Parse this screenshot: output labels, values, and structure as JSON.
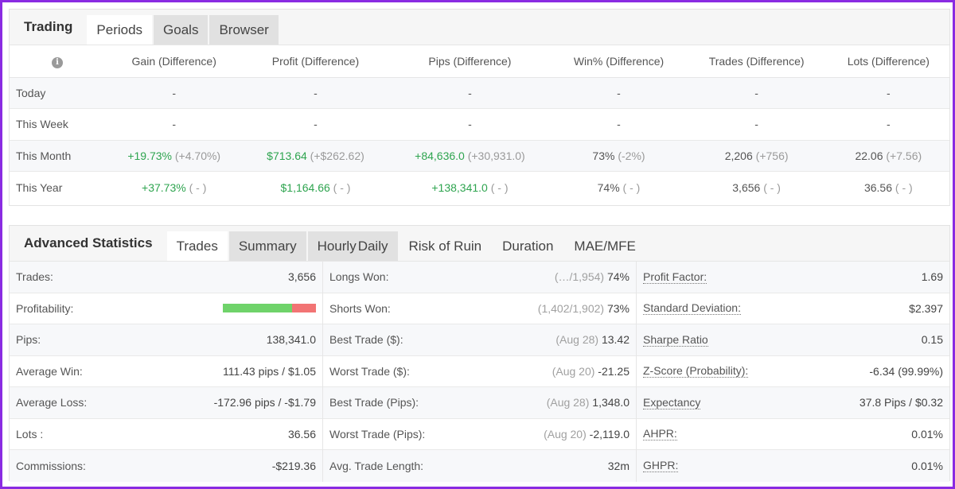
{
  "periods_panel": {
    "tabs": [
      {
        "label": "Trading",
        "type": "title"
      },
      {
        "label": "Periods",
        "active": true
      },
      {
        "label": "Goals"
      },
      {
        "label": "Browser"
      }
    ],
    "info_icon": "i",
    "columns": [
      "Gain (Difference)",
      "Profit (Difference)",
      "Pips (Difference)",
      "Win% (Difference)",
      "Trades (Difference)",
      "Lots (Difference)"
    ],
    "rows": [
      {
        "label": "Today",
        "cells": [
          {
            "main": "-",
            "diff": ""
          },
          {
            "main": "-",
            "diff": ""
          },
          {
            "main": "-",
            "diff": ""
          },
          {
            "main": "-",
            "diff": ""
          },
          {
            "main": "-",
            "diff": ""
          },
          {
            "main": "-",
            "diff": ""
          }
        ]
      },
      {
        "label": "This Week",
        "cells": [
          {
            "main": "-",
            "diff": ""
          },
          {
            "main": "-",
            "diff": ""
          },
          {
            "main": "-",
            "diff": ""
          },
          {
            "main": "-",
            "diff": ""
          },
          {
            "main": "-",
            "diff": ""
          },
          {
            "main": "-",
            "diff": ""
          }
        ]
      },
      {
        "label": "This Month",
        "cells": [
          {
            "main": "+19.73%",
            "diff": "(+4.70%)",
            "positive": true
          },
          {
            "main": "$713.64",
            "diff": "(+$262.62)",
            "positive": true
          },
          {
            "main": "+84,636.0",
            "diff": "(+30,931.0)",
            "positive": true
          },
          {
            "main": "73%",
            "diff": "(-2%)"
          },
          {
            "main": "2,206",
            "diff": "(+756)"
          },
          {
            "main": "22.06",
            "diff": "(+7.56)"
          }
        ]
      },
      {
        "label": "This Year",
        "cells": [
          {
            "main": "+37.73%",
            "diff": "( - )",
            "positive": true
          },
          {
            "main": "$1,164.66",
            "diff": "( - )",
            "positive": true
          },
          {
            "main": "+138,341.0",
            "diff": "( - )",
            "positive": true
          },
          {
            "main": "74%",
            "diff": "( - )"
          },
          {
            "main": "3,656",
            "diff": "( - )"
          },
          {
            "main": "36.56",
            "diff": "( - )"
          }
        ]
      }
    ]
  },
  "advanced_panel": {
    "title": "Advanced Statistics",
    "tabs": [
      {
        "label": "Trades",
        "active": true
      },
      {
        "label": "Summary"
      },
      {
        "label": "Hourly",
        "overlap": "Daily"
      },
      {
        "label": "Risk of Ruin"
      },
      {
        "label": "Duration"
      },
      {
        "label": "MAE/MFE"
      }
    ],
    "columns": [
      [
        {
          "label": "Trades:",
          "value": "3,656"
        },
        {
          "label": "Profitability:",
          "bar": {
            "win_fraction": 0.74,
            "loss_fraction": 0.26
          }
        },
        {
          "label": "Pips:",
          "value": "138,341.0"
        },
        {
          "label": "Average Win:",
          "value": "111.43 pips / $1.05"
        },
        {
          "label": "Average Loss:",
          "value": "-172.96 pips / -$1.79"
        },
        {
          "label": "Lots :",
          "value": "36.56"
        },
        {
          "label": "Commissions:",
          "value": "-$219.36"
        }
      ],
      [
        {
          "label": "Longs Won:",
          "aside": "(…/1,954)",
          "value": "74%"
        },
        {
          "label": "Shorts Won:",
          "aside": "(1,402/1,902)",
          "value": "73%"
        },
        {
          "label": "Best Trade ($):",
          "aside": "(Aug 28)",
          "value": "13.42"
        },
        {
          "label": "Worst Trade ($):",
          "aside": "(Aug 20)",
          "value": "-21.25"
        },
        {
          "label": "Best Trade (Pips):",
          "aside": "(Aug 28)",
          "value": "1,348.0"
        },
        {
          "label": "Worst Trade (Pips):",
          "aside": "(Aug 20)",
          "value": "-2,119.0"
        },
        {
          "label": "Avg. Trade Length:",
          "value": "32m"
        }
      ],
      [
        {
          "label": "Profit Factor:",
          "value": "1.69",
          "dotted": true
        },
        {
          "label": "Standard Deviation:",
          "value": "$2.397",
          "dotted": true
        },
        {
          "label": "Sharpe Ratio",
          "value": "0.15",
          "dotted": true
        },
        {
          "label": "Z-Score (Probability):",
          "value": "-6.34 (99.99%)",
          "dotted": true
        },
        {
          "label": "Expectancy",
          "value": "37.8 Pips / $0.32",
          "dotted": true
        },
        {
          "label": "AHPR:",
          "value": "0.01%",
          "dotted": true
        },
        {
          "label": "GHPR:",
          "value": "0.01%",
          "dotted": true
        }
      ]
    ]
  },
  "colors": {
    "positive": "#2ea44f",
    "win_bar": "#6fd36a",
    "loss_bar": "#f27474",
    "frame": "#8a2be2"
  }
}
